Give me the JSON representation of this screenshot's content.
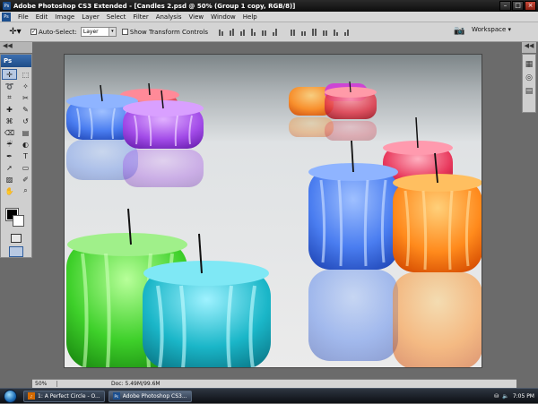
{
  "window": {
    "title": "Adobe Photoshop CS3 Extended - [Candles 2.psd @ 50% (Group 1 copy, RGB/8)]",
    "ps_badge": "Ps"
  },
  "menu": [
    "File",
    "Edit",
    "Image",
    "Layer",
    "Select",
    "Filter",
    "Analysis",
    "View",
    "Window",
    "Help"
  ],
  "options": {
    "auto_select_label": "Auto-Select:",
    "auto_select_checked": true,
    "auto_select_value": "Layer",
    "show_transform_label": "Show Transform Controls",
    "show_transform_checked": false,
    "workspace_label": "Workspace ▾"
  },
  "toolbox": {
    "header": "Ps",
    "tools": [
      "move",
      "marquee",
      "lasso",
      "magic-wand",
      "crop",
      "slice",
      "healing",
      "brush",
      "stamp",
      "history-brush",
      "eraser",
      "gradient",
      "blur",
      "dodge",
      "pen",
      "type",
      "path-select",
      "shape",
      "notes",
      "eyedropper",
      "hand",
      "zoom"
    ],
    "tool_glyphs": [
      "✛",
      "⬚",
      "➰",
      "✧",
      "⌗",
      "✂",
      "✚",
      "✎",
      "⌘",
      "↺",
      "⌫",
      "▤",
      "☔",
      "◐",
      "✒",
      "T",
      "➚",
      "▭",
      "▨",
      "✐",
      "✋",
      "⌕"
    ],
    "foreground_color": "#000000",
    "background_color": "#ffffff"
  },
  "panel_collapse_glyph": "◀◀",
  "right_panel_icons": [
    "▦",
    "◎",
    "▤"
  ],
  "status": {
    "zoom": "50%",
    "doc": "Doc: 5.49M/99.6M"
  },
  "taskbar": {
    "tasks": [
      {
        "label": "1: A Perfect Circle - O...",
        "active": false
      },
      {
        "label": "Adobe Photoshop CS3...",
        "active": true
      }
    ],
    "time": "7:05 PM"
  },
  "colors": {
    "blue": "#4a7df0",
    "purple": "#a24be8",
    "red": "#e23a4c",
    "orange": "#ff8a1c",
    "pink": "#e8385c",
    "green": "#3ed02a",
    "cyan": "#1ab6c8"
  }
}
